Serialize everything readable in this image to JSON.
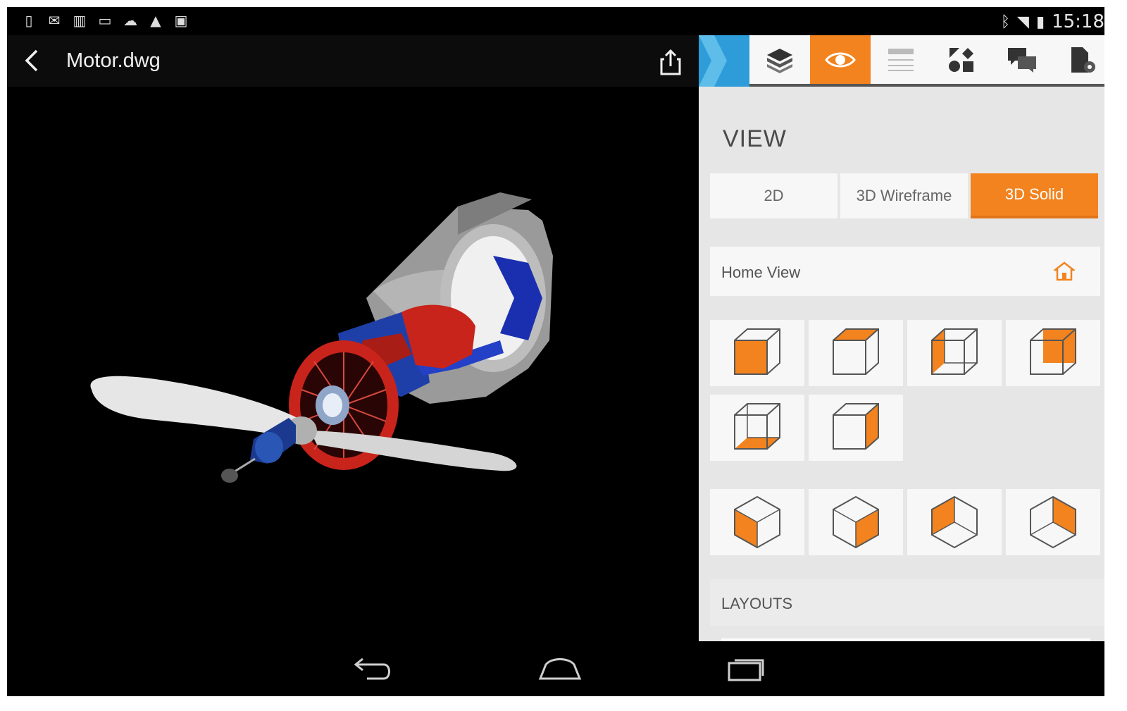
{
  "status_bar": {
    "notification_icons": [
      "phone-icon",
      "mail-icon",
      "barcode-icon",
      "image-icon",
      "cloud-upload-icon",
      "warning-icon",
      "store-icon"
    ],
    "time": "15:18",
    "system_icons": [
      "bluetooth-icon",
      "wifi-icon",
      "battery-icon"
    ]
  },
  "app_bar": {
    "title": "Motor.dwg",
    "back_icon": "chevron-left-icon",
    "share_icon": "share-icon"
  },
  "panel": {
    "tabs": [
      {
        "name": "layers",
        "icon": "layers-icon",
        "active": false
      },
      {
        "name": "view",
        "icon": "eye-icon",
        "active": true
      },
      {
        "name": "properties",
        "icon": "sliders-icon",
        "active": false
      },
      {
        "name": "blocks",
        "icon": "shapes-icon",
        "active": false
      },
      {
        "name": "comments",
        "icon": "chat-icon",
        "active": false
      },
      {
        "name": "file-settings",
        "icon": "file-gear-icon",
        "active": false
      }
    ],
    "section_title": "VIEW",
    "view_modes": [
      {
        "label": "2D",
        "active": false
      },
      {
        "label": "3D Wireframe",
        "active": false
      },
      {
        "label": "3D Solid",
        "active": true
      }
    ],
    "home_view": {
      "label": "Home View",
      "icon": "home-icon"
    },
    "ortho_views": [
      "front",
      "top",
      "left",
      "right",
      "bottom",
      "back"
    ],
    "iso_views": [
      "sw-iso",
      "se-iso",
      "ne-iso",
      "nw-iso"
    ],
    "layouts_title": "LAYOUTS"
  },
  "viewport": {
    "undo_icon": "undo-icon",
    "redo_icon": "redo-icon",
    "fit_icon": "fit-screen-icon"
  },
  "nav_bar": {
    "buttons": [
      "back-nav-icon",
      "home-nav-icon",
      "recents-nav-icon"
    ]
  },
  "colors": {
    "accent": "#f2831e",
    "panel_bg": "#e6e6e6",
    "collapse_tab": "#2d9cd8",
    "model_red": "#c8241b",
    "model_blue": "#1f3fa8",
    "model_gray": "#9a9a9a"
  }
}
